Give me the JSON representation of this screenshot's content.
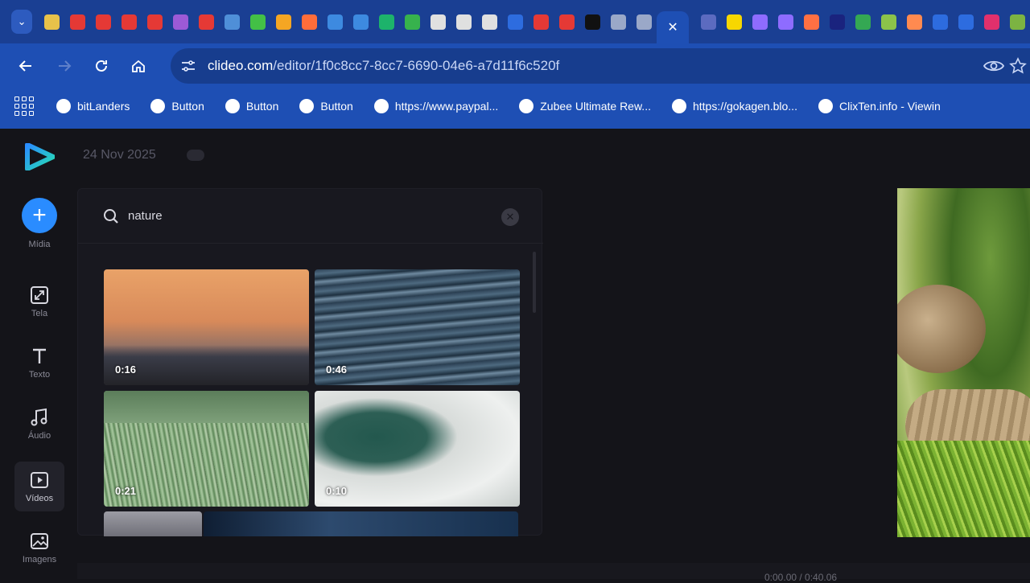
{
  "browser": {
    "active_tab_close": "✕",
    "tab_favicons": [
      "#e8c24a",
      "#e53935",
      "#e53935",
      "#e53935",
      "#e53935",
      "#9c5ad6",
      "#e53935",
      "#4f8fd8",
      "#43c046",
      "#f5a623",
      "#ff6d3a",
      "#3d8ae0",
      "#3d8ae0",
      "#1db36b",
      "#37b24d",
      "#e0e0e0",
      "#e0e0e0",
      "#e0e0e0",
      "#2d6cdf",
      "#e53935",
      "#e53935",
      "#111111",
      "#9aa8c8",
      "#9aa8c8"
    ],
    "tab_favicons_right": [
      "#5c6bc0",
      "#f7d700",
      "#8e6cff",
      "#8e6cff",
      "#ff7043",
      "#1a237e",
      "#34a853",
      "#8bc34a",
      "#ff8a50",
      "#2d6cdf",
      "#2d6cdf",
      "#e1306c",
      "#7cb342"
    ],
    "url_host": "clideo.com",
    "url_path": "/editor/1f0c8cc7-8cc7-6690-04e6-a7d11f6c520f",
    "bookmarks": [
      {
        "label": "bitLanders"
      },
      {
        "label": "Button"
      },
      {
        "label": "Button"
      },
      {
        "label": "Button"
      },
      {
        "label": "https://www.paypal..."
      },
      {
        "label": "Zubee Ultimate Rew..."
      },
      {
        "label": "https://gokagen.blo..."
      },
      {
        "label": "ClixTen.info - Viewin"
      }
    ]
  },
  "editor": {
    "date": "24 Nov 2025",
    "rail": [
      {
        "label": "Mídia",
        "icon": "plus-icon"
      },
      {
        "label": "Tela",
        "icon": "resize-icon"
      },
      {
        "label": "Texto",
        "icon": "text-icon"
      },
      {
        "label": "Áudio",
        "icon": "music-icon"
      },
      {
        "label": "Vídeos",
        "icon": "video-icon"
      },
      {
        "label": "Imagens",
        "icon": "image-icon"
      }
    ],
    "search": {
      "value": "nature",
      "placeholder": "Search"
    },
    "thumbnails": [
      {
        "duration": "0:16"
      },
      {
        "duration": "0:46"
      },
      {
        "duration": "0:21"
      },
      {
        "duration": "0:10"
      }
    ],
    "timeline_time": "0:00.00 / 0:40.06"
  },
  "colors": {
    "accent": "#2a8cff",
    "chrome": "#1e4fb4",
    "background": "#141419"
  }
}
